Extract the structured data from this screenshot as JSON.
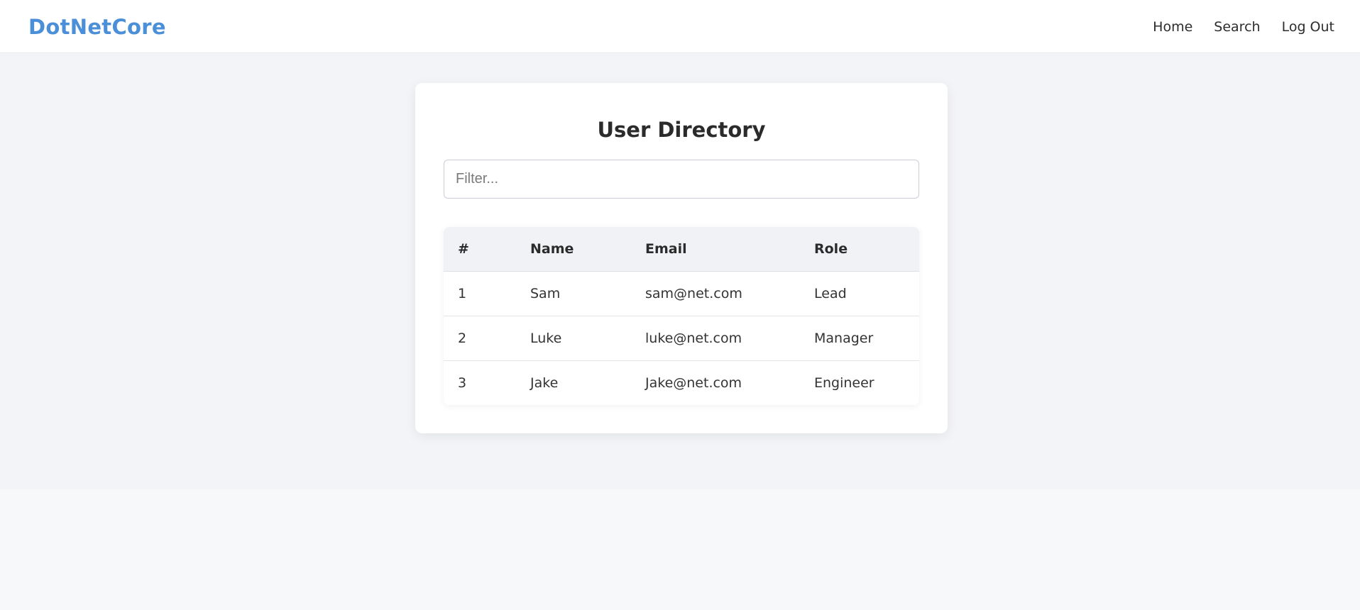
{
  "brand": {
    "name": "DotNetCore",
    "color": "#4a8fd8"
  },
  "nav": {
    "items": [
      {
        "label": "Home"
      },
      {
        "label": "Search"
      },
      {
        "label": "Log Out"
      }
    ]
  },
  "directory": {
    "title": "User Directory",
    "filter": {
      "placeholder": "Filter...",
      "value": ""
    },
    "columns": [
      "#",
      "Name",
      "Email",
      "Role"
    ],
    "rows": [
      {
        "id": "1",
        "name": "Sam",
        "email": "sam@net.com",
        "role": "Lead"
      },
      {
        "id": "2",
        "name": "Luke",
        "email": "luke@net.com",
        "role": "Manager"
      },
      {
        "id": "3",
        "name": "Jake",
        "email": "Jake@net.com",
        "role": "Engineer"
      }
    ]
  }
}
